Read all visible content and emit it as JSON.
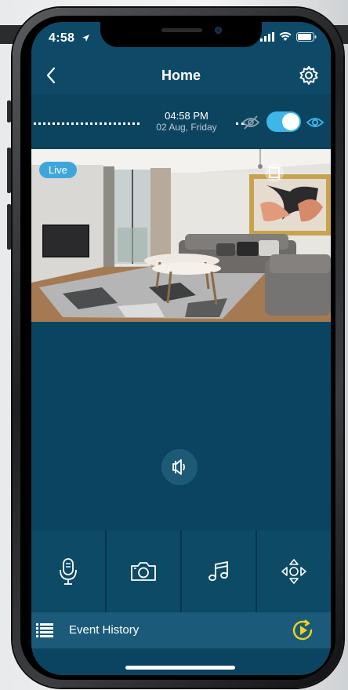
{
  "status_bar": {
    "time": "4:58",
    "icons": [
      "location-arrow-icon",
      "signal-icon",
      "wifi-icon",
      "battery-icon"
    ]
  },
  "nav": {
    "title": "Home",
    "back_icon": "chevron-left-icon",
    "settings_icon": "gear-icon"
  },
  "timeline": {
    "time": "04:58 PM",
    "date": "02 Aug, Friday",
    "privacy_toggle_on": true
  },
  "video": {
    "live_label": "Live"
  },
  "controls": [
    {
      "name": "microphone-icon"
    },
    {
      "name": "camera-icon"
    },
    {
      "name": "music-note-icon"
    },
    {
      "name": "pan-tilt-icon"
    }
  ],
  "event_bar": {
    "label": "Event History"
  },
  "colors": {
    "primary": "#0c4460",
    "header": "#0e4a67",
    "accent": "#3fb6ea",
    "event_bar": "#1b5b79",
    "play_yellow": "#f4d21f"
  }
}
